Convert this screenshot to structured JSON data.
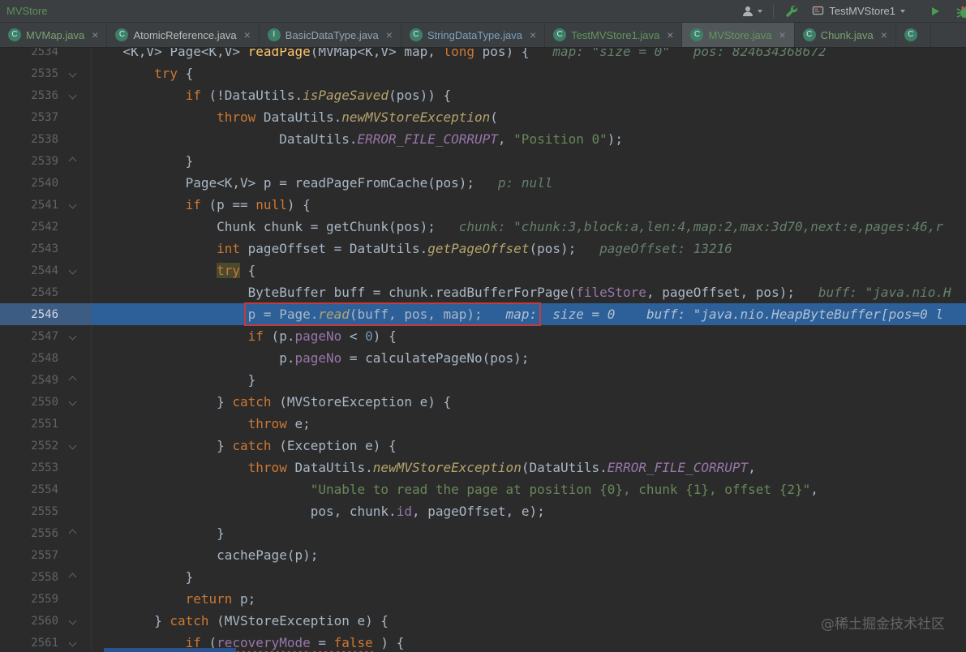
{
  "topbar": {
    "project": "MVStore",
    "run_config": "TestMVStore1",
    "icons": [
      "user-icon",
      "chevron-down-icon",
      "build-hammer-icon",
      "run-config-app-icon",
      "run-play-icon",
      "debug-bug-icon"
    ]
  },
  "ui": {
    "close_glyph": "×"
  },
  "tabs": [
    {
      "label": "MVMap.java",
      "letter": "C",
      "color": "#7BA073",
      "selected": false
    },
    {
      "label": "AtomicReference.java",
      "letter": "C",
      "color": "#BBBBBB",
      "selected": false
    },
    {
      "label": "BasicDataType.java",
      "letter": "I",
      "color": "#93A5B4",
      "selected": false
    },
    {
      "label": "StringDataType.java",
      "letter": "C",
      "color": "#7AA0BE",
      "selected": false
    },
    {
      "label": "TestMVStore1.java",
      "letter": "C",
      "color": "#62965F",
      "selected": false
    },
    {
      "label": "MVStore.java",
      "letter": "C",
      "color": "#62965F",
      "selected": true
    },
    {
      "label": "Chunk.java",
      "letter": "C",
      "color": "#7BA073",
      "selected": false
    },
    {
      "label": "",
      "letter": "C",
      "color": "#BBBBBB",
      "selected": false
    }
  ],
  "colors": {
    "editor_bg": "#2B2B2B",
    "bar_bg": "#3C3F41",
    "debug_current_line": "#2D6099",
    "annotation_box_red": "#C43B3B",
    "run_green": "#499C54"
  },
  "watermark": "@稀土掘金技术社区",
  "editor": {
    "current_line": 2546,
    "lines": [
      {
        "no": "2534",
        "tokens": [
          {
            "t": "    <K,V> Page<K,V> ",
            "c": "p"
          },
          {
            "t": "readPage",
            "c": "decl"
          },
          {
            "t": "(MVMap<K,V> map, ",
            "c": "p"
          },
          {
            "t": "long",
            "c": "k"
          },
          {
            "t": " pos) {",
            "c": "p"
          },
          {
            "t": "   map: \"size = 0\"   pos: 824634368672",
            "c": "dbg"
          }
        ]
      },
      {
        "no": "2535",
        "fold": "down",
        "tokens": [
          {
            "t": "        ",
            "c": "p"
          },
          {
            "t": "try",
            "c": "k"
          },
          {
            "t": " {",
            "c": "p"
          }
        ]
      },
      {
        "no": "2536",
        "fold": "down",
        "tokens": [
          {
            "t": "            ",
            "c": "p"
          },
          {
            "t": "if",
            "c": "k"
          },
          {
            "t": " (!DataUtils.",
            "c": "p"
          },
          {
            "t": "isPageSaved",
            "c": "sm"
          },
          {
            "t": "(pos)) {",
            "c": "p"
          }
        ]
      },
      {
        "no": "2537",
        "tokens": [
          {
            "t": "                ",
            "c": "p"
          },
          {
            "t": "throw",
            "c": "k"
          },
          {
            "t": " DataUtils.",
            "c": "p"
          },
          {
            "t": "newMVStoreException",
            "c": "sm"
          },
          {
            "t": "(",
            "c": "p"
          }
        ]
      },
      {
        "no": "2538",
        "tokens": [
          {
            "t": "                        DataUtils.",
            "c": "p"
          },
          {
            "t": "ERROR_FILE_CORRUPT",
            "c": "fi"
          },
          {
            "t": ", ",
            "c": "p"
          },
          {
            "t": "\"Position 0\"",
            "c": "s"
          },
          {
            "t": ");",
            "c": "p"
          }
        ]
      },
      {
        "no": "2539",
        "fold": "up",
        "tokens": [
          {
            "t": "            }",
            "c": "p"
          }
        ]
      },
      {
        "no": "2540",
        "tokens": [
          {
            "t": "            Page<K,V> p = readPageFromCache(pos);",
            "c": "p"
          },
          {
            "t": "   p: null",
            "c": "dbg"
          }
        ]
      },
      {
        "no": "2541",
        "fold": "down",
        "tokens": [
          {
            "t": "            ",
            "c": "p"
          },
          {
            "t": "if",
            "c": "k"
          },
          {
            "t": " (p == ",
            "c": "p"
          },
          {
            "t": "null",
            "c": "k"
          },
          {
            "t": ") {",
            "c": "p"
          }
        ]
      },
      {
        "no": "2542",
        "tokens": [
          {
            "t": "                Chunk chunk = getChunk(pos);",
            "c": "p"
          },
          {
            "t": "   chunk: \"chunk:3,block:a,len:4,map:2,max:3d70,next:e,pages:46,r",
            "c": "dbg"
          }
        ]
      },
      {
        "no": "2543",
        "tokens": [
          {
            "t": "                ",
            "c": "p"
          },
          {
            "t": "int",
            "c": "k"
          },
          {
            "t": " pageOffset = DataUtils.",
            "c": "p"
          },
          {
            "t": "getPageOffset",
            "c": "sm"
          },
          {
            "t": "(pos);",
            "c": "p"
          },
          {
            "t": "   pageOffset: 13216",
            "c": "dbg"
          }
        ]
      },
      {
        "no": "2544",
        "fold": "down",
        "tokens": [
          {
            "t": "                ",
            "c": "p"
          },
          {
            "t": "try",
            "c": "k hl"
          },
          {
            "t": " {",
            "c": "p"
          }
        ]
      },
      {
        "no": "2545",
        "tokens": [
          {
            "t": "                    ByteBuffer buff = chunk.readBufferForPage(",
            "c": "p"
          },
          {
            "t": "fileStore",
            "c": "f"
          },
          {
            "t": ", pageOffset, pos);",
            "c": "p"
          },
          {
            "t": "   buff: \"java.nio.H",
            "c": "dbg"
          }
        ]
      },
      {
        "no": "2546",
        "current": true,
        "tokens": [
          {
            "t": "                    ",
            "c": "p"
          },
          {
            "t": "p = Page.",
            "c": "p",
            "g": "redbox"
          },
          {
            "t": "read",
            "c": "sm",
            "g": "redbox"
          },
          {
            "t": "(buff, pos, map);",
            "c": "p",
            "g": "redbox"
          },
          {
            "t": "   map:",
            "c": "dbgl",
            "g": "redbox"
          },
          {
            "t": "  size = 0",
            "c": "dbgl"
          },
          {
            "t": "    buff: \"java.nio.HeapByteBuffer[pos=0 l",
            "c": "dbgl"
          }
        ]
      },
      {
        "no": "2547",
        "fold": "down",
        "tokens": [
          {
            "t": "                    ",
            "c": "p"
          },
          {
            "t": "if",
            "c": "k"
          },
          {
            "t": " (p.",
            "c": "p"
          },
          {
            "t": "pageNo",
            "c": "f"
          },
          {
            "t": " < ",
            "c": "p"
          },
          {
            "t": "0",
            "c": "n"
          },
          {
            "t": ") {",
            "c": "p"
          }
        ]
      },
      {
        "no": "2548",
        "tokens": [
          {
            "t": "                        p.",
            "c": "p"
          },
          {
            "t": "pageNo",
            "c": "f"
          },
          {
            "t": " = calculatePageNo(pos);",
            "c": "p"
          }
        ]
      },
      {
        "no": "2549",
        "fold": "up",
        "tokens": [
          {
            "t": "                    }",
            "c": "p"
          }
        ]
      },
      {
        "no": "2550",
        "fold": "down",
        "tokens": [
          {
            "t": "                } ",
            "c": "p"
          },
          {
            "t": "catch",
            "c": "k"
          },
          {
            "t": " (MVStoreException e) {",
            "c": "p"
          }
        ]
      },
      {
        "no": "2551",
        "tokens": [
          {
            "t": "                    ",
            "c": "p"
          },
          {
            "t": "throw",
            "c": "k"
          },
          {
            "t": " e;",
            "c": "p"
          }
        ]
      },
      {
        "no": "2552",
        "fold": "down",
        "tokens": [
          {
            "t": "                } ",
            "c": "p"
          },
          {
            "t": "catch",
            "c": "k"
          },
          {
            "t": " (Exception e) {",
            "c": "p"
          }
        ]
      },
      {
        "no": "2553",
        "tokens": [
          {
            "t": "                    ",
            "c": "p"
          },
          {
            "t": "throw",
            "c": "k"
          },
          {
            "t": " DataUtils.",
            "c": "p"
          },
          {
            "t": "newMVStoreException",
            "c": "sm"
          },
          {
            "t": "(DataUtils.",
            "c": "p"
          },
          {
            "t": "ERROR_FILE_CORRUPT",
            "c": "fi"
          },
          {
            "t": ",",
            "c": "p"
          }
        ]
      },
      {
        "no": "2554",
        "tokens": [
          {
            "t": "                            ",
            "c": "p"
          },
          {
            "t": "\"Unable to read the page at position {0}, chunk {1}, offset {2}\"",
            "c": "s"
          },
          {
            "t": ",",
            "c": "p"
          }
        ]
      },
      {
        "no": "2555",
        "tokens": [
          {
            "t": "                            pos, chunk.",
            "c": "p"
          },
          {
            "t": "id",
            "c": "f"
          },
          {
            "t": ", pageOffset, e);",
            "c": "p"
          }
        ]
      },
      {
        "no": "2556",
        "fold": "up",
        "tokens": [
          {
            "t": "                }",
            "c": "p"
          }
        ]
      },
      {
        "no": "2557",
        "tokens": [
          {
            "t": "                cachePage(p);",
            "c": "p"
          }
        ]
      },
      {
        "no": "2558",
        "fold": "up",
        "tokens": [
          {
            "t": "            }",
            "c": "p"
          }
        ]
      },
      {
        "no": "2559",
        "tokens": [
          {
            "t": "            ",
            "c": "p"
          },
          {
            "t": "return",
            "c": "k"
          },
          {
            "t": " p;",
            "c": "p"
          }
        ]
      },
      {
        "no": "2560",
        "fold": "down",
        "tokens": [
          {
            "t": "        } ",
            "c": "p"
          },
          {
            "t": "catch",
            "c": "k"
          },
          {
            "t": " (MVStoreException e) {",
            "c": "p"
          }
        ]
      },
      {
        "no": "2561",
        "fold": "down",
        "tokens": [
          {
            "t": "            ",
            "c": "p"
          },
          {
            "t": "if",
            "c": "k"
          },
          {
            "t": " (",
            "c": "p"
          },
          {
            "t": "recoveryMode",
            "c": "f",
            "g": "warn"
          },
          {
            "t": " = ",
            "c": "p",
            "g": "warn"
          },
          {
            "t": "false",
            "c": "k",
            "g": "warn"
          },
          {
            "t": " ) {",
            "c": "p"
          }
        ]
      }
    ]
  }
}
